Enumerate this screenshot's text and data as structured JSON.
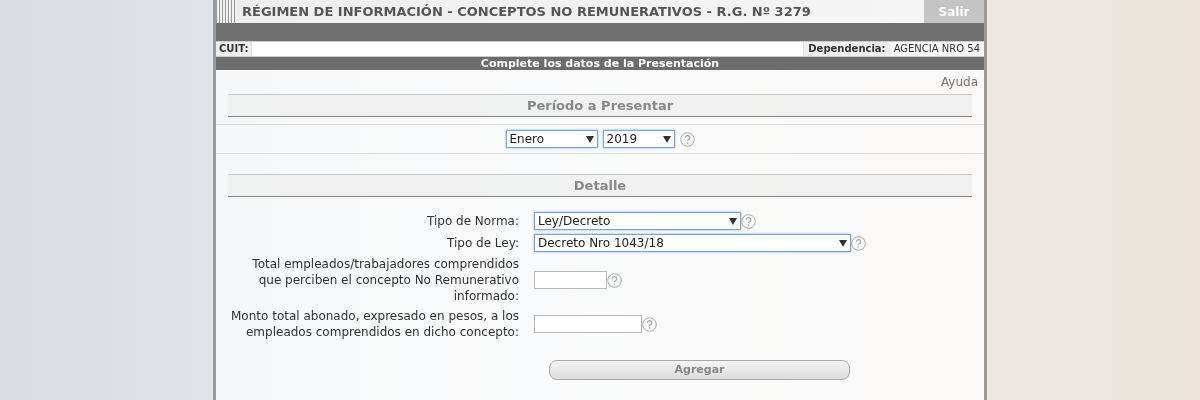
{
  "header": {
    "title": "RÉGIMEN DE INFORMACIÓN - CONCEPTOS NO REMUNERATIVOS - R.G. Nº 3279",
    "exit_button": "Salir"
  },
  "info_bar": {
    "cuit_label": "CUIT:",
    "dependencia_label": "Dependencia:",
    "dependencia_value": "AGENCIA NRO 54"
  },
  "section_bar": "Complete los datos de la Presentación",
  "help_link": "Ayuda",
  "periodo": {
    "heading": "Período a Presentar",
    "month": "Enero",
    "year": "2019"
  },
  "detalle": {
    "heading": "Detalle",
    "fields": [
      {
        "kind": "select",
        "label": "Tipo de Norma:",
        "value": "Ley/Decreto"
      },
      {
        "kind": "select",
        "label": "Tipo de Ley:",
        "value": "Decreto Nro 1043/18"
      },
      {
        "kind": "text",
        "label": "Total empleados/trabajadores comprendidos que perciben el concepto No Remunerativo informado:"
      },
      {
        "kind": "text",
        "label": "Monto total abonado, expresado en pesos, a los empleados comprendidos en dicho concepto:"
      }
    ],
    "add_button": "Agregar"
  }
}
